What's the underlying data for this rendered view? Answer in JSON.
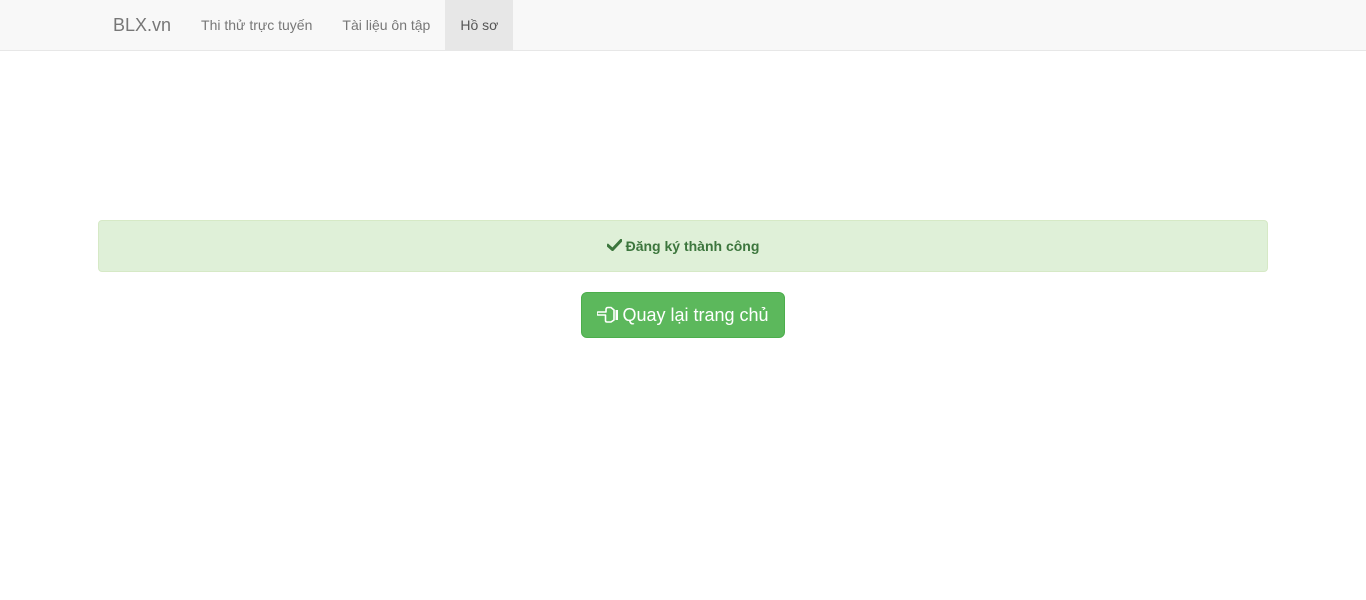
{
  "navbar": {
    "brand": "BLX.vn",
    "items": [
      {
        "label": "Thi thử trực tuyến",
        "active": false
      },
      {
        "label": "Tài liệu ôn tập",
        "active": false
      },
      {
        "label": "Hồ sơ",
        "active": true
      }
    ]
  },
  "alert": {
    "icon": "check-icon",
    "message": "Đăng ký thành công",
    "color": "#3c763d",
    "background": "#dff0d8"
  },
  "home_button": {
    "icon": "hand-pointing-left-icon",
    "label": "Quay lại trang chủ",
    "color": "#5cb85c"
  }
}
